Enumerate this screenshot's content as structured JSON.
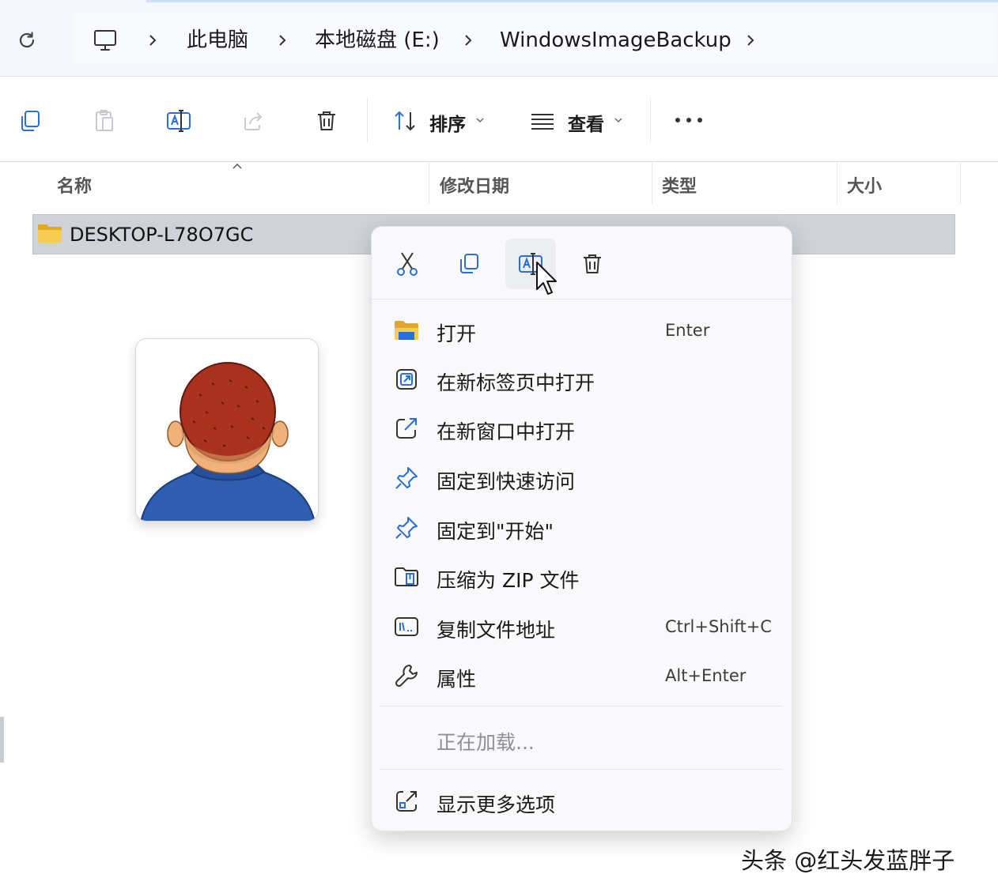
{
  "address_bar": {
    "refresh_icon": "refresh-icon",
    "pc_icon": "this-pc-icon",
    "crumbs": [
      "此电脑",
      "本地磁盘 (E:)",
      "WindowsImageBackup"
    ]
  },
  "toolbar": {
    "buttons": [
      "copy-icon",
      "paste-icon",
      "rename-icon",
      "share-icon",
      "delete-icon"
    ],
    "sort_label": "排序",
    "view_label": "查看",
    "more_icon": "more-icon"
  },
  "columns": [
    "名称",
    "修改日期",
    "类型",
    "大小"
  ],
  "files": [
    {
      "name": "DESKTOP-L78O7GC",
      "icon": "folder-icon",
      "selected": true
    }
  ],
  "context_menu": {
    "quick_actions": [
      "cut-icon",
      "copy-icon",
      "rename-icon",
      "delete-icon"
    ],
    "hovered_action": "rename-icon",
    "items": [
      {
        "label": "打开",
        "shortcut": "Enter",
        "icon": "folder-open-icon"
      },
      {
        "label": "在新标签页中打开",
        "shortcut": "",
        "icon": "new-tab-icon"
      },
      {
        "label": "在新窗口中打开",
        "shortcut": "",
        "icon": "new-window-icon"
      },
      {
        "label": "固定到快速访问",
        "shortcut": "",
        "icon": "pin-icon"
      },
      {
        "label": "固定到\"开始\"",
        "shortcut": "",
        "icon": "pin-icon"
      },
      {
        "label": "压缩为 ZIP 文件",
        "shortcut": "",
        "icon": "zip-icon"
      },
      {
        "label": "复制文件地址",
        "shortcut": "Ctrl+Shift+C",
        "icon": "copy-path-icon"
      },
      {
        "label": "属性",
        "shortcut": "Alt+Enter",
        "icon": "wrench-icon"
      }
    ],
    "loading_label": "正在加载...",
    "more_options_label": "显示更多选项",
    "more_options_icon": "show-more-icon"
  },
  "colors": {
    "folder": "#f2c744",
    "accent_blue": "#2a6fd6",
    "selection": "#cfd2d8",
    "avatar_hair": "#a8321e",
    "avatar_shirt": "#2f5db0"
  },
  "watermark": "头条 @红头发蓝胖子"
}
